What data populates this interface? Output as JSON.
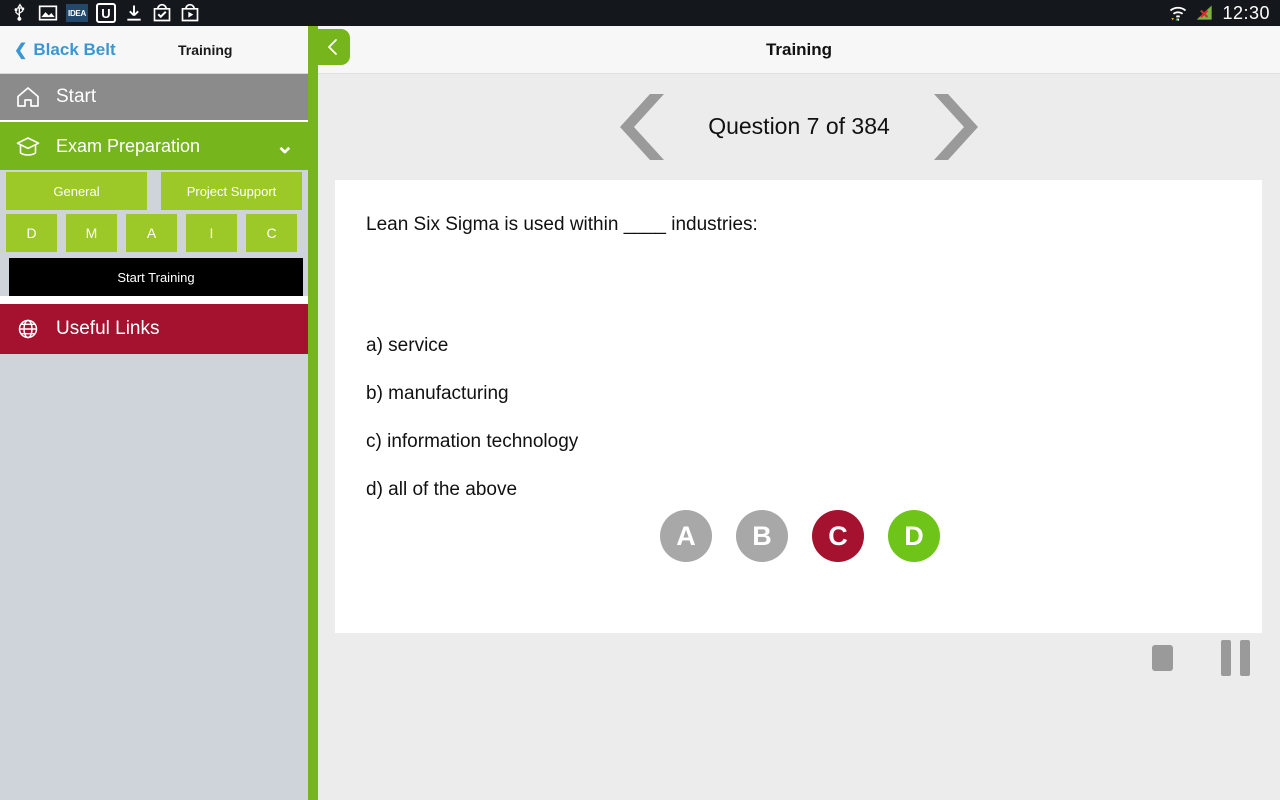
{
  "statusbar": {
    "icons": [
      "usb-icon",
      "gallery-icon",
      "idea-icon",
      "u-app-icon",
      "download-icon",
      "checkbox-bag-icon",
      "play-bag-icon"
    ],
    "idea_label": "IDEA",
    "u_label": "U",
    "wifi_icon": "wifi-icon",
    "signal_icon": "signal-off-icon",
    "clock": "12:30",
    "bg": "#14171c"
  },
  "sidebar": {
    "back_label": "Black Belt",
    "back_chevron": "❮",
    "title": "Training",
    "items": [
      {
        "label": "Start",
        "icon": "home-icon",
        "color": "#8b8b8b"
      },
      {
        "label": "Exam Preparation",
        "icon": "graduation-cap-icon",
        "color": "#76b51c",
        "caret": "⌄"
      },
      {
        "label": "Useful Links",
        "icon": "globe-icon",
        "color": "#a4122f"
      }
    ],
    "categories": [
      {
        "label": "General"
      },
      {
        "label": "Project Support"
      }
    ],
    "dmaic": [
      {
        "label": "D"
      },
      {
        "label": "M"
      },
      {
        "label": "A"
      },
      {
        "label": "I"
      },
      {
        "label": "C"
      }
    ],
    "start_training_label": "Start Training",
    "accent_green": "#76b51c",
    "light_green": "#9cc927",
    "crimson": "#a4122f"
  },
  "main": {
    "header_title": "Training",
    "back_button_icon": "chevron-left-icon",
    "question_counter": "Question 7 of 384",
    "prev_icon": "chevron-left-big-icon",
    "next_icon": "chevron-right-big-icon",
    "question_text": "Lean Six Sigma is used within ____ industries:",
    "answers": [
      "a) service",
      "b) manufacturing",
      "c) information technology",
      "d) all of the above"
    ],
    "choices": [
      {
        "label": "A",
        "color": "#a8a8a8"
      },
      {
        "label": "B",
        "color": "#a8a8a8"
      },
      {
        "label": "C",
        "color": "#a4122f"
      },
      {
        "label": "D",
        "color": "#6fc419"
      }
    ],
    "transport": {
      "stop_icon": "stop-icon",
      "pause_icon": "pause-icon"
    }
  }
}
